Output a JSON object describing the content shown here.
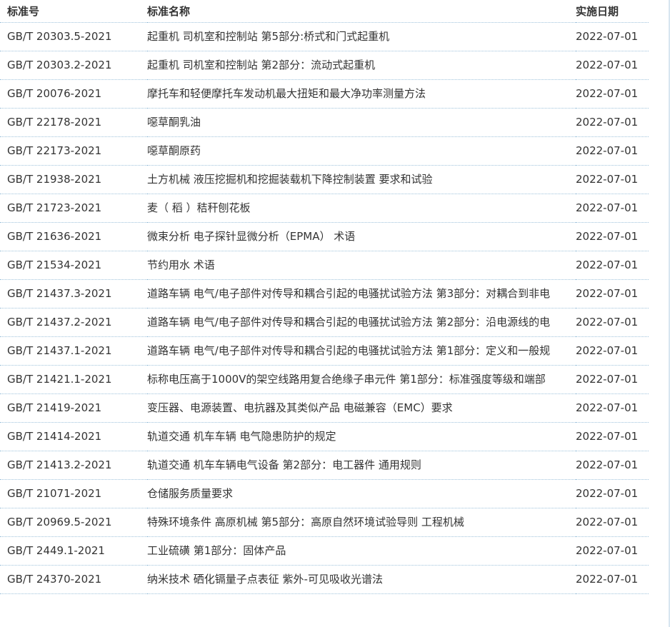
{
  "header": {
    "col_code": "标准号",
    "col_name": "标准名称",
    "col_date": "实施日期"
  },
  "rows": [
    {
      "code": "GB/T 20303.5-2021",
      "name": "起重机 司机室和控制站 第5部分:桥式和门式起重机",
      "date": "2022-07-01"
    },
    {
      "code": "GB/T 20303.2-2021",
      "name": "起重机 司机室和控制站 第2部分：流动式起重机",
      "date": "2022-07-01"
    },
    {
      "code": "GB/T 20076-2021",
      "name": "摩托车和轻便摩托车发动机最大扭矩和最大净功率测量方法",
      "date": "2022-07-01"
    },
    {
      "code": "GB/T 22178-2021",
      "name": "噁草酮乳油",
      "date": "2022-07-01"
    },
    {
      "code": "GB/T 22173-2021",
      "name": "噁草酮原药",
      "date": "2022-07-01"
    },
    {
      "code": "GB/T 21938-2021",
      "name": "土方机械 液压挖掘机和挖掘装载机下降控制装置 要求和试验",
      "date": "2022-07-01"
    },
    {
      "code": "GB/T 21723-2021",
      "name": "麦（ 稻 ）秸秆刨花板",
      "date": "2022-07-01"
    },
    {
      "code": "GB/T 21636-2021",
      "name": "微束分析 电子探针显微分析（EPMA） 术语",
      "date": "2022-07-01"
    },
    {
      "code": "GB/T 21534-2021",
      "name": "节约用水 术语",
      "date": "2022-07-01"
    },
    {
      "code": "GB/T 21437.3-2021",
      "name": "道路车辆 电气/电子部件对传导和耦合引起的电骚扰试验方法 第3部分：对耦合到非电",
      "date": "2022-07-01"
    },
    {
      "code": "GB/T 21437.2-2021",
      "name": "道路车辆 电气/电子部件对传导和耦合引起的电骚扰试验方法 第2部分：沿电源线的电",
      "date": "2022-07-01"
    },
    {
      "code": "GB/T 21437.1-2021",
      "name": "道路车辆 电气/电子部件对传导和耦合引起的电骚扰试验方法 第1部分：定义和一般规",
      "date": "2022-07-01"
    },
    {
      "code": "GB/T 21421.1-2021",
      "name": "标称电压高于1000V的架空线路用复合绝缘子串元件 第1部分：标准强度等级和端部",
      "date": "2022-07-01"
    },
    {
      "code": "GB/T 21419-2021",
      "name": "变压器、电源装置、电抗器及其类似产品 电磁兼容（EMC）要求",
      "date": "2022-07-01"
    },
    {
      "code": "GB/T 21414-2021",
      "name": "轨道交通 机车车辆 电气隐患防护的规定",
      "date": "2022-07-01"
    },
    {
      "code": "GB/T 21413.2-2021",
      "name": "轨道交通 机车车辆电气设备 第2部分：电工器件 通用规则",
      "date": "2022-07-01"
    },
    {
      "code": "GB/T 21071-2021",
      "name": "仓储服务质量要求",
      "date": "2022-07-01"
    },
    {
      "code": "GB/T 20969.5-2021",
      "name": "特殊环境条件 高原机械 第5部分：高原自然环境试验导则 工程机械",
      "date": "2022-07-01"
    },
    {
      "code": "GB/T 2449.1-2021",
      "name": "工业硫磺 第1部分：固体产品",
      "date": "2022-07-01"
    },
    {
      "code": "GB/T 24370-2021",
      "name": "纳米技术 硒化镉量子点表征 紫外-可见吸收光谱法",
      "date": "2022-07-01"
    }
  ]
}
